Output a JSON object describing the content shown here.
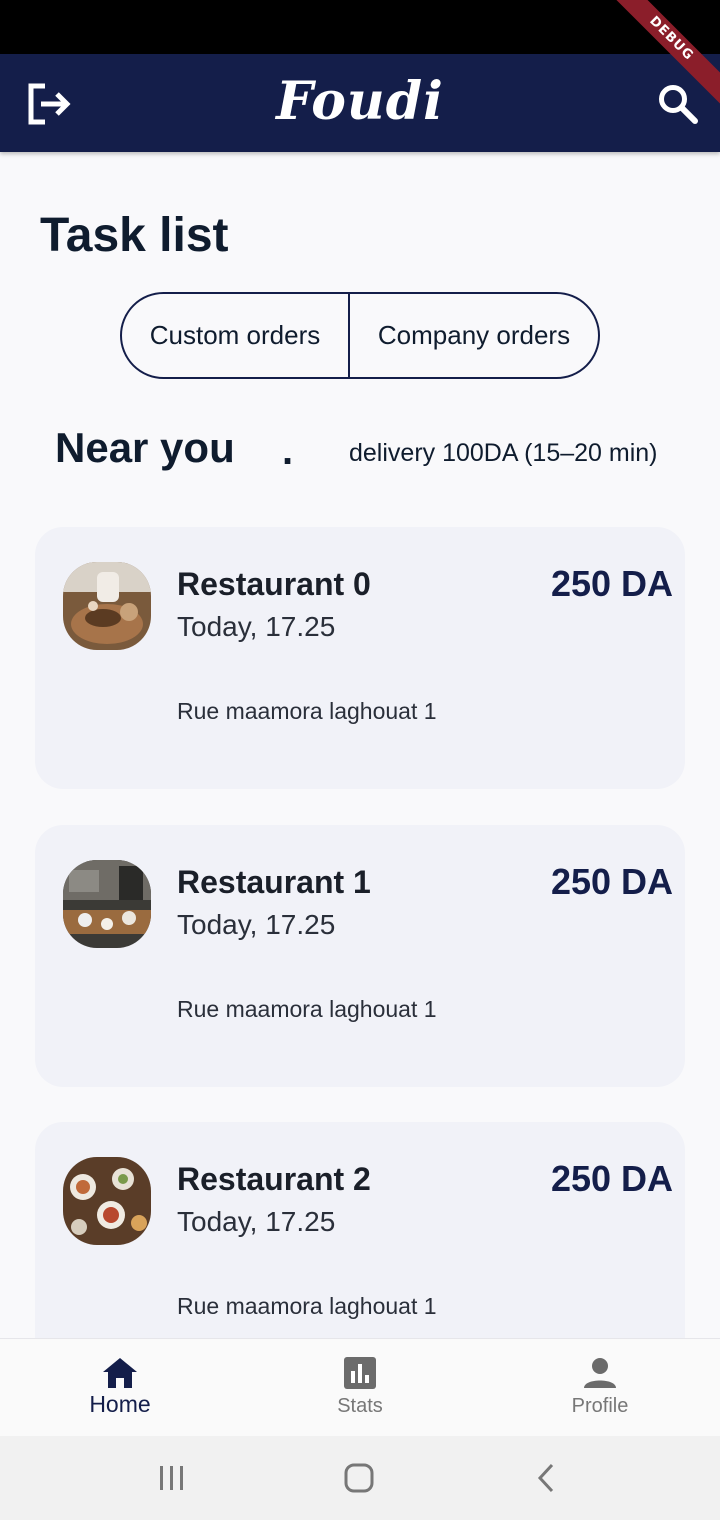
{
  "app": {
    "title": "Foudi",
    "debug_banner": "DEBUG",
    "colors": {
      "primary": "#141e4a",
      "card": "#f1f2f8",
      "background": "#f9f9fb"
    }
  },
  "page": {
    "title": "Task list",
    "toggle": {
      "options": [
        "Custom orders",
        "Company orders"
      ]
    },
    "section": {
      "title": "Near you",
      "separator": ".",
      "delivery": "delivery 100DA (15–20 min)"
    }
  },
  "orders": [
    {
      "name": "Restaurant 0",
      "time": "Today, 17.25",
      "price": "250 DA",
      "address": "Rue maamora laghouat 1",
      "image": "restaurant-photo"
    },
    {
      "name": "Restaurant 1",
      "time": "Today, 17.25",
      "price": "250 DA",
      "address": "Rue maamora laghouat 1",
      "image": "restaurant-photo"
    },
    {
      "name": "Restaurant 2",
      "time": "Today, 17.25",
      "price": "250 DA",
      "address": "Rue maamora laghouat 1",
      "image": "restaurant-photo"
    }
  ],
  "bottom_nav": {
    "items": [
      {
        "label": "Home",
        "icon": "home-icon",
        "active": true
      },
      {
        "label": "Stats",
        "icon": "bar-chart-icon",
        "active": false
      },
      {
        "label": "Profile",
        "icon": "person-icon",
        "active": false
      }
    ]
  },
  "system_nav": {
    "icons": [
      "recents-icon",
      "home-button-icon",
      "back-icon"
    ]
  }
}
